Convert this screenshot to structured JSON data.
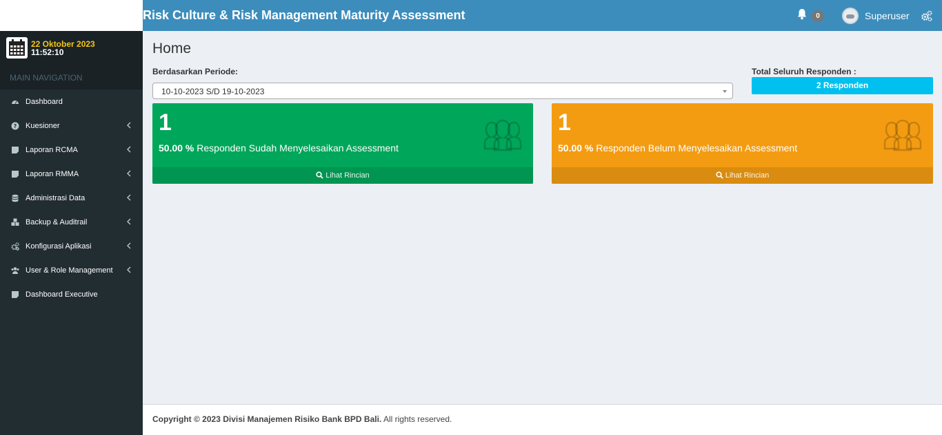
{
  "header": {
    "app_title": "Risk Culture & Risk Management Maturity Assessment",
    "notification_count": "0",
    "user_name": "Superuser"
  },
  "sidebar": {
    "date": "22 Oktober 2023",
    "time": "11:52:10",
    "nav_header": "MAIN NAVIGATION",
    "items": [
      {
        "label": "Dashboard",
        "icon": "dashboard-icon",
        "has_submenu": false
      },
      {
        "label": "Kuesioner",
        "icon": "question-circle-icon",
        "has_submenu": true
      },
      {
        "label": "Laporan RCMA",
        "icon": "document-icon",
        "has_submenu": true
      },
      {
        "label": "Laporan RMMA",
        "icon": "document-icon",
        "has_submenu": true
      },
      {
        "label": "Administrasi Data",
        "icon": "database-icon",
        "has_submenu": true
      },
      {
        "label": "Backup & Auditrail",
        "icon": "cubes-icon",
        "has_submenu": true
      },
      {
        "label": "Konfigurasi Aplikasi",
        "icon": "gears-icon",
        "has_submenu": true
      },
      {
        "label": "User & Role Management",
        "icon": "users-icon",
        "has_submenu": true
      },
      {
        "label": "Dashboard Executive",
        "icon": "document-icon",
        "has_submenu": false
      }
    ]
  },
  "main": {
    "page_title": "Home",
    "periode_label": "Berdasarkan Periode:",
    "periode_selected": "10-10-2023 S/D 19-10-2023",
    "total_label": "Total Seluruh Responden :",
    "total_value": "2 Responden",
    "boxes": [
      {
        "number": "1",
        "percent": "50.00 %",
        "description": "Responden Sudah Menyelesaikan Assessment",
        "footer": "Lihat Rincian",
        "color": "#00a65a"
      },
      {
        "number": "1",
        "percent": "50.00 %",
        "description": "Responden Belum Menyelesaikan Assessment",
        "footer": "Lihat Rincian",
        "color": "#f39c12"
      }
    ]
  },
  "footer": {
    "copyright": "Copyright © 2023 Divisi Manajemen Risiko Bank BPD Bali.",
    "rights": "All rights reserved."
  },
  "colors": {
    "header_bg": "#3c8dbc",
    "sidebar_bg": "#222d32",
    "date_color": "#f5c518",
    "info_badge": "#00c0ef"
  }
}
